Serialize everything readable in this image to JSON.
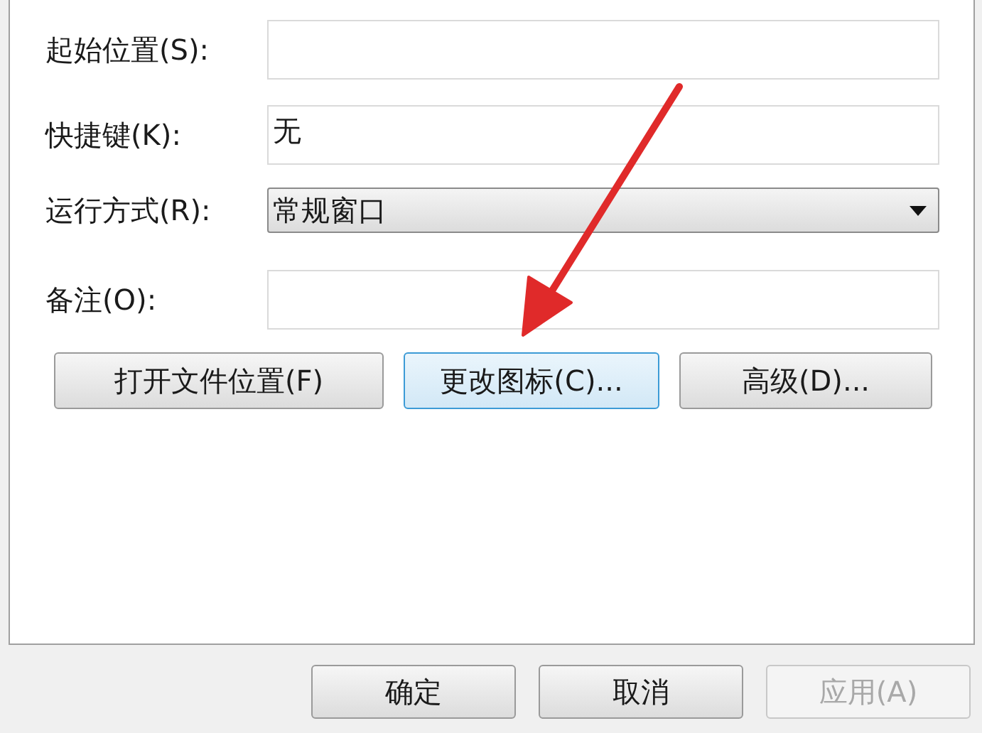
{
  "fields": [
    {
      "label": "起始位置(S):",
      "kind": "text"
    },
    {
      "label": "快捷键(K):",
      "kind": "text",
      "value": "无"
    },
    {
      "label": "运行方式(R):",
      "kind": "dropdown",
      "value": "常规窗口"
    },
    {
      "label": "备注(O):",
      "kind": "text"
    }
  ],
  "actions": [
    {
      "label": "打开文件位置(F)",
      "focused": false
    },
    {
      "label": "更改图标(C)...",
      "focused": true
    },
    {
      "label": "高级(D)...",
      "focused": false
    }
  ],
  "dialog_buttons": [
    {
      "label": "确定",
      "disabled": false
    },
    {
      "label": "取消",
      "disabled": false
    },
    {
      "label": "应用(A)",
      "disabled": true
    }
  ]
}
